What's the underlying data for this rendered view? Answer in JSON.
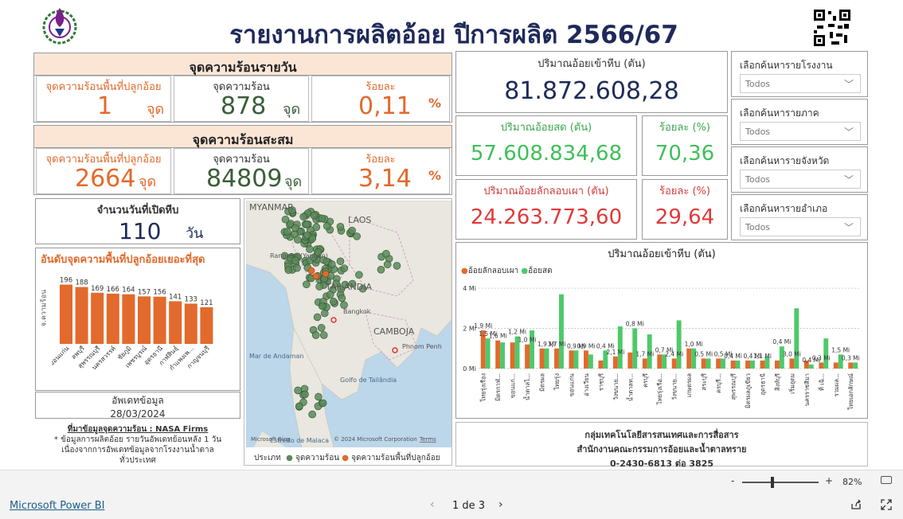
{
  "header": {
    "title": "รายงานการผลิตอ้อย ปีการผลิต 2566/67"
  },
  "daily": {
    "title": "จุดความร้อนรายวัน",
    "plant_label": "จุดความร้อนพื้นที่ปลูกอ้อย",
    "plant_value": "1",
    "plant_unit": "จุด",
    "hot_label": "จุดความร้อน",
    "hot_value": "878",
    "hot_unit": "จุด",
    "pct_label": "ร้อยละ",
    "pct_value": "0,11",
    "pct_unit": "%"
  },
  "cumulative": {
    "title": "จุดความร้อนสะสม",
    "plant_label": "จุดความร้อนพื้นที่ปลูกอ้อย",
    "plant_value": "2664",
    "plant_unit": "จุด",
    "hot_label": "จุดความร้อน",
    "hot_value": "84809",
    "hot_unit": "จุด",
    "pct_label": "ร้อยละ",
    "pct_value": "3,14",
    "pct_unit": "%"
  },
  "days": {
    "label": "จำนวนวันที่เปิดหีบ",
    "value": "110",
    "unit": "วัน"
  },
  "ranking": {
    "title": "อันดับจุดความพื้นที่ปลูกอ้อยเยอะที่สุด",
    "ylabel": "จ.ความร้อน"
  },
  "update": {
    "label": "อัพเดทข้อมูล",
    "date": "28/03/2024"
  },
  "notes": {
    "source": "ที่มาข้อมูลจุดความร้อน : NASA Firms",
    "line1": "* ข้อมูลการผลิตอ้อย รายวันอัพเดทย้อนหลัง 1 วัน",
    "line2": "เนื่องจากการอัพเดทข้อมูลจากโรงงานน้ำตาล",
    "line3": "ทั่วประเทศ"
  },
  "kpi": {
    "total_label": "ปริมาณอ้อยเข้าหีบ (ตัน)",
    "total_value": "81.872.608,28",
    "fresh_label": "ปริมาณอ้อยสด (ตัน)",
    "fresh_value": "57.608.834,68",
    "fresh_pct_label": "ร้อยละ (%)",
    "fresh_pct_value": "70,36",
    "burnt_label": "ปริมาณอ้อยลักลอบเผา (ตัน)",
    "burnt_value": "24.263.773,60",
    "burnt_pct_label": "ร้อยละ (%)",
    "burnt_pct_value": "29,64"
  },
  "filters": [
    {
      "label": "เลือกค้นหารายโรงงาน",
      "value": "Todos"
    },
    {
      "label": "เลือกค้นหารายภาค",
      "value": "Todos"
    },
    {
      "label": "เลือกค้นหารายจังหวัด",
      "value": "Todos"
    },
    {
      "label": "เลือกค้นหารายอำเภอ",
      "value": "Todos"
    }
  ],
  "map": {
    "labels": [
      "MYANMAR",
      "LAOS",
      "TAILÂNDIA",
      "CAMBOJA",
      "Mar de Andaman",
      "Golfo de Tailândia",
      "Phnom Penh",
      "Rangoon (Yangon)",
      "Bangkok",
      "Estreito de Malaca"
    ],
    "copyright": "© 2024 Microsoft Corporation",
    "terms": "Terms",
    "bing": "Microsoft Bing",
    "legend_title": "ประเภท",
    "legend_hot": "จุดความร้อน",
    "legend_plant": "จุดความร้อนพื้นที่ปลูกอ้อย",
    "colors": {
      "hot": "#5a8a5a",
      "plant": "#e26a2c"
    }
  },
  "contact": {
    "line1": "กลุ่มเทคโนโลยีสารสนเทศและการสื่อสาร",
    "line2": "สำนักงานคณะกรรมการอ้อยและน้ำตาลทราย",
    "line3": "0-2430-6813 ต่อ 3825"
  },
  "chart_data": [
    {
      "type": "bar",
      "title": "อันดับจุดความพื้นที่ปลูกอ้อยเยอะที่สุด",
      "ylabel": "จ.ความร้อน",
      "categories": [
        "ขอนแก่น",
        "ลพบุรี",
        "สุพรรณบุรี",
        "นครสวรรค์",
        "ชัยภูมิ",
        "เพชรบูรณ์",
        "อุดรธานี",
        "กาฬสินธุ์",
        "กำแพงเพ...",
        "กาญจนบุรี"
      ],
      "values": [
        196,
        188,
        169,
        166,
        164,
        157,
        156,
        141,
        133,
        121
      ],
      "data_labels": [
        "196",
        "188",
        "169",
        "166",
        "164",
        "157",
        "156",
        "141",
        "133",
        "121"
      ],
      "ylim": [
        0,
        200
      ],
      "color": "#e26a2c"
    },
    {
      "type": "bar",
      "title": "ปริมาณอ้อยเข้าหีบ (ตัน)",
      "series": [
        {
          "name": "อ้อยลักลอบเผา",
          "color": "#e26a2c",
          "values": [
            1.9,
            1.4,
            1.3,
            1.2,
            1.0,
            1.0,
            0.9,
            0.9,
            0.4,
            0.6,
            0.8,
            0.5,
            0.7,
            0.5,
            1.0,
            0.5,
            0.5,
            0.4,
            0.4,
            0.4,
            0.4,
            0.5,
            0.4,
            0.3,
            0.3,
            0.3
          ]
        },
        {
          "name": "อ้อยสด",
          "color": "#4ec96a",
          "values": [
            1.5,
            1.3,
            1.6,
            1.9,
            1.0,
            3.7,
            0.9,
            0.7,
            0.9,
            2.1,
            2.0,
            1.7,
            0.7,
            2.4,
            1.0,
            0.5,
            0.5,
            0.4,
            0.4,
            0.6,
            1.1,
            3.0,
            0.2,
            1.5,
            0.7,
            0.3
          ]
        }
      ],
      "categories": [
        "ไทยรุ่งเรือง",
        "มิตรกาฬ...",
        "ขอนแก่...",
        "น้ำตาลไ...",
        "มิตรผล",
        "ไทยรุ่ง",
        "ขอนแก่น",
        "อ่างเวียน",
        "ราชบุรี",
        "วังขนาย...",
        "น้ำตาลท...",
        "ครบุรี",
        "ไทยรุ่งเรือ...",
        "วังขนาย...",
        "เกษตรผล",
        "สระบุรี",
        "ครบุรี...",
        "สุพรรณบุรี",
        "มิตรผลภูเขียว",
        "อุดรธานี",
        "สิงห์บุรี",
        "เริ่มอุดม",
        "นครราชสีมา",
        "ที่ เฉิ...",
        "รวมผล...",
        "ไทยเอกลักษณ์"
      ],
      "value_labels": [
        "1,9 Mi",
        "1,5 Mi",
        "1,6 Mi",
        "1,2 Mi",
        "1,0 Mi",
        "1,9 Mi",
        "3,7 Mi",
        "0,9 Mi",
        "0,9 Mi",
        "0,4 Mi",
        "2,1 Mi",
        "0,8 Mi",
        "1,7 Mi",
        "0,7 Mi",
        "2,4 Mi",
        "1,0 Mi",
        "0,5 Mi",
        "0,5 Mi",
        "0,4 Mi",
        "0,4 Mi",
        "1,1 Mi",
        "0,4 Mi",
        "3,0 Mi",
        "0,4 Mi",
        "0,3 Mi",
        "1,5 Mi",
        "0,3 Mi"
      ],
      "y_ticks": [
        "0 Mi",
        "2 Mi",
        "4 Mi"
      ],
      "ylim": [
        0,
        4.2
      ]
    }
  ],
  "footer": {
    "brand": "Microsoft Power BI",
    "page": "1 de 3",
    "zoom": "82%",
    "zoom_minus": "-",
    "zoom_plus": "+"
  }
}
